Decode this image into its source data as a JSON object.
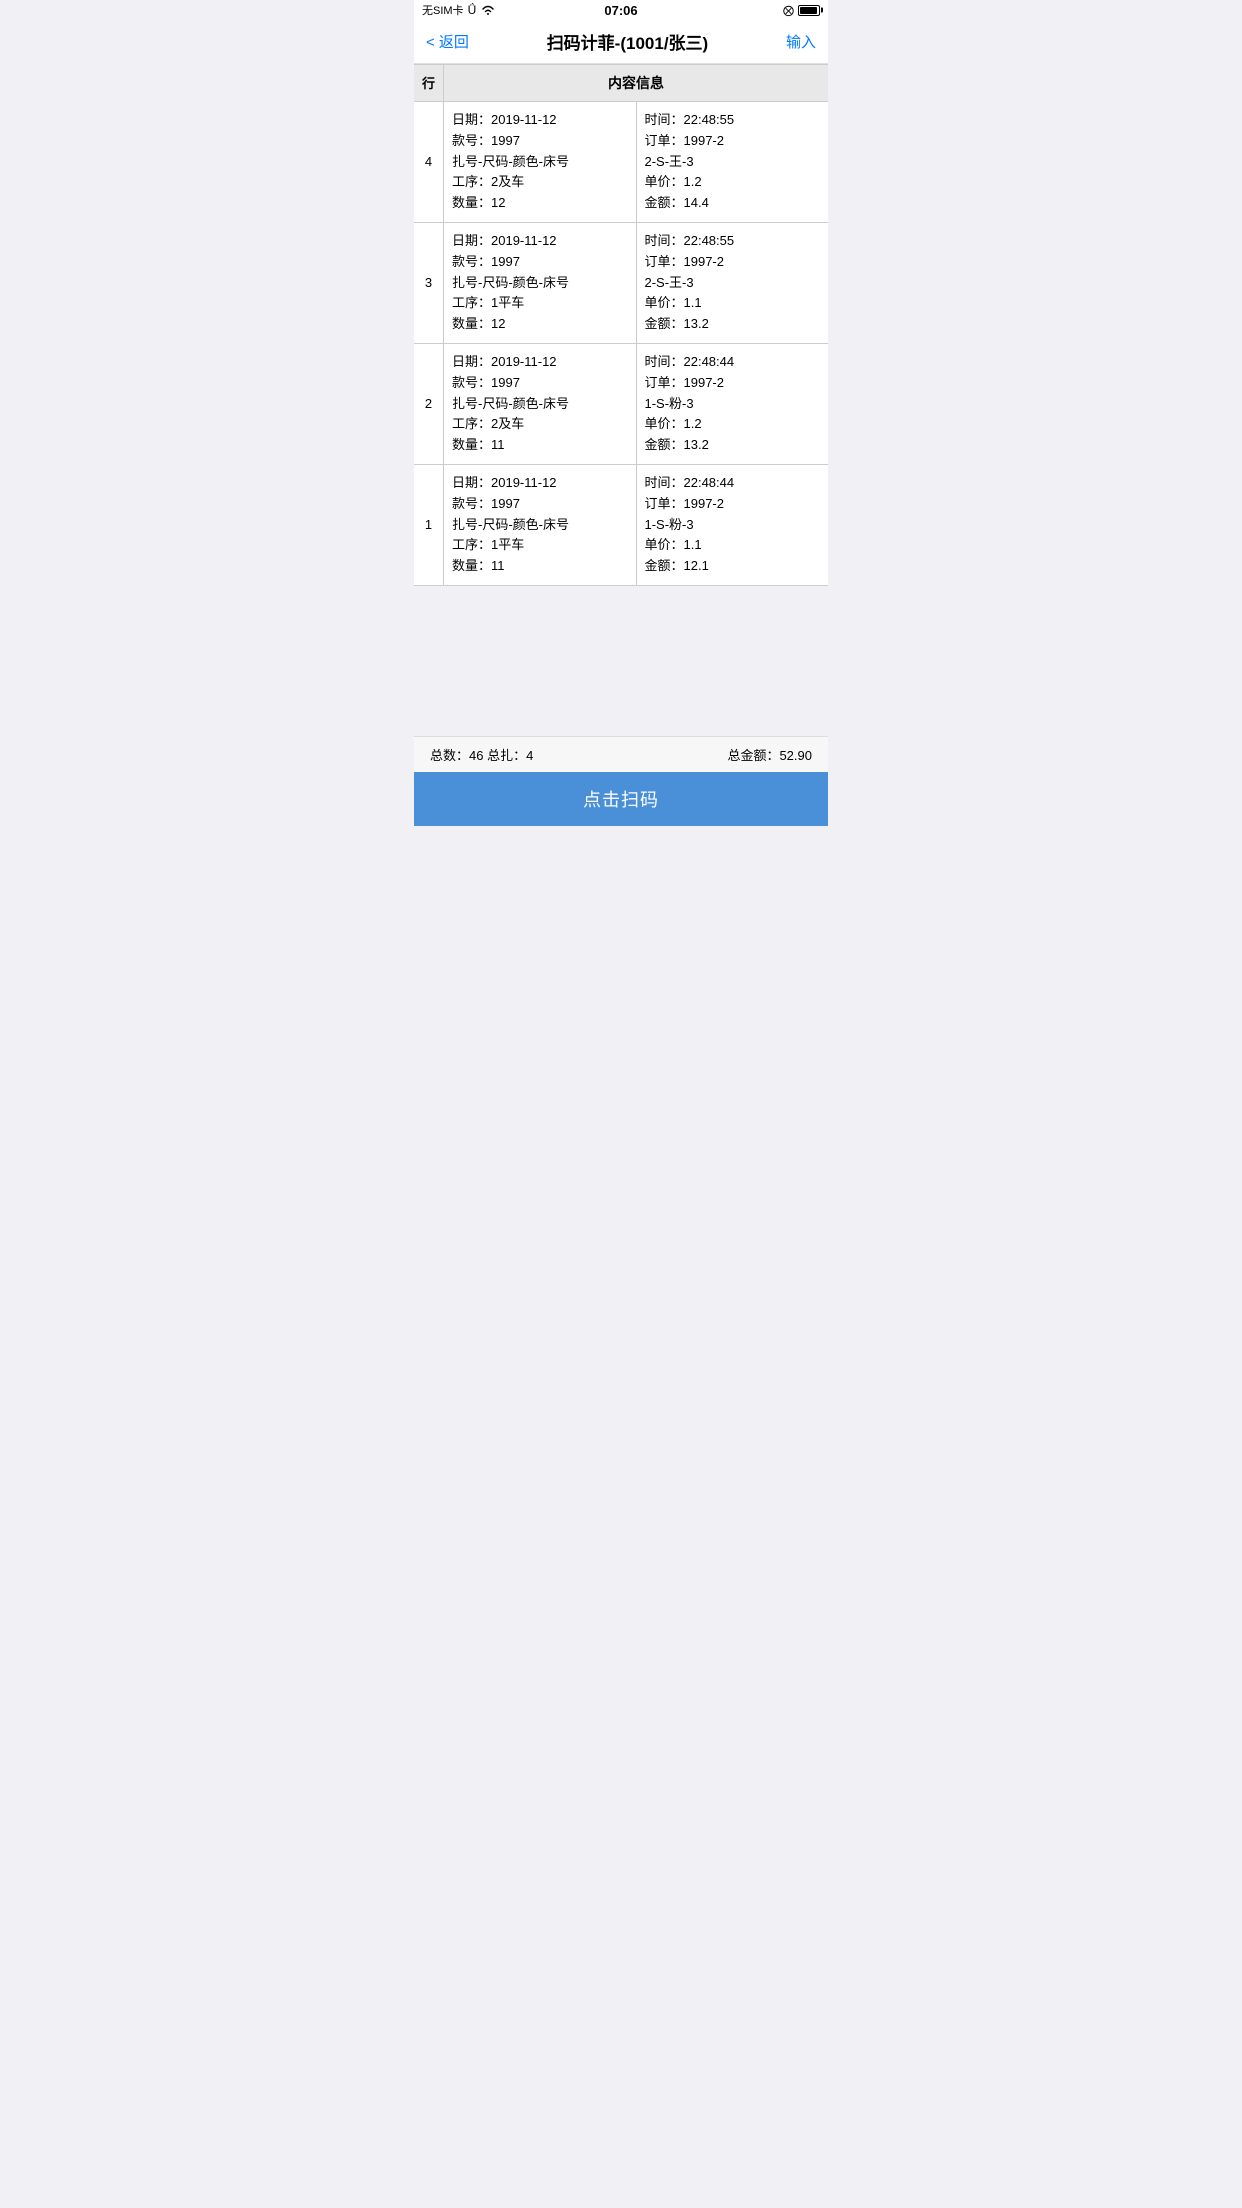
{
  "statusBar": {
    "carrier": "无SIM卡",
    "wifi": "wifi",
    "time": "07:06",
    "locationIcon": "⊕"
  },
  "navBar": {
    "backLabel": "< 返回",
    "title": "扫码计菲-(1001/张三)",
    "actionLabel": "输入"
  },
  "tableHeader": {
    "rowLabel": "行",
    "contentLabel": "内容信息"
  },
  "rows": [
    {
      "rowNum": "4",
      "leftLines": [
        "日期：2019-11-12",
        "款号：1997",
        "扎号-尺码-颜色-床号",
        "工序：2及车",
        "数量：12"
      ],
      "rightLines": [
        "时间：22:48:55",
        "订单：1997-2",
        "2-S-王-3",
        "单价：1.2",
        "金额：14.4"
      ]
    },
    {
      "rowNum": "3",
      "leftLines": [
        "日期：2019-11-12",
        "款号：1997",
        "扎号-尺码-颜色-床号",
        "工序：1平车",
        "数量：12"
      ],
      "rightLines": [
        "时间：22:48:55",
        "订单：1997-2",
        "2-S-王-3",
        "单价：1.1",
        "金额：13.2"
      ]
    },
    {
      "rowNum": "2",
      "leftLines": [
        "日期：2019-11-12",
        "款号：1997",
        "扎号-尺码-颜色-床号",
        "工序：2及车",
        "数量：11"
      ],
      "rightLines": [
        "时间：22:48:44",
        "订单：1997-2",
        "1-S-粉-3",
        "单价：1.2",
        "金额：13.2"
      ]
    },
    {
      "rowNum": "1",
      "leftLines": [
        "日期：2019-11-12",
        "款号：1997",
        "扎号-尺码-颜色-床号",
        "工序：1平车",
        "数量：11"
      ],
      "rightLines": [
        "时间：22:48:44",
        "订单：1997-2",
        "1-S-粉-3",
        "单价：1.1",
        "金额：12.1"
      ]
    }
  ],
  "footer": {
    "leftText": "总数：46 总扎：4",
    "rightText": "总金额：52.90"
  },
  "scanButton": {
    "label": "点击扫码"
  }
}
